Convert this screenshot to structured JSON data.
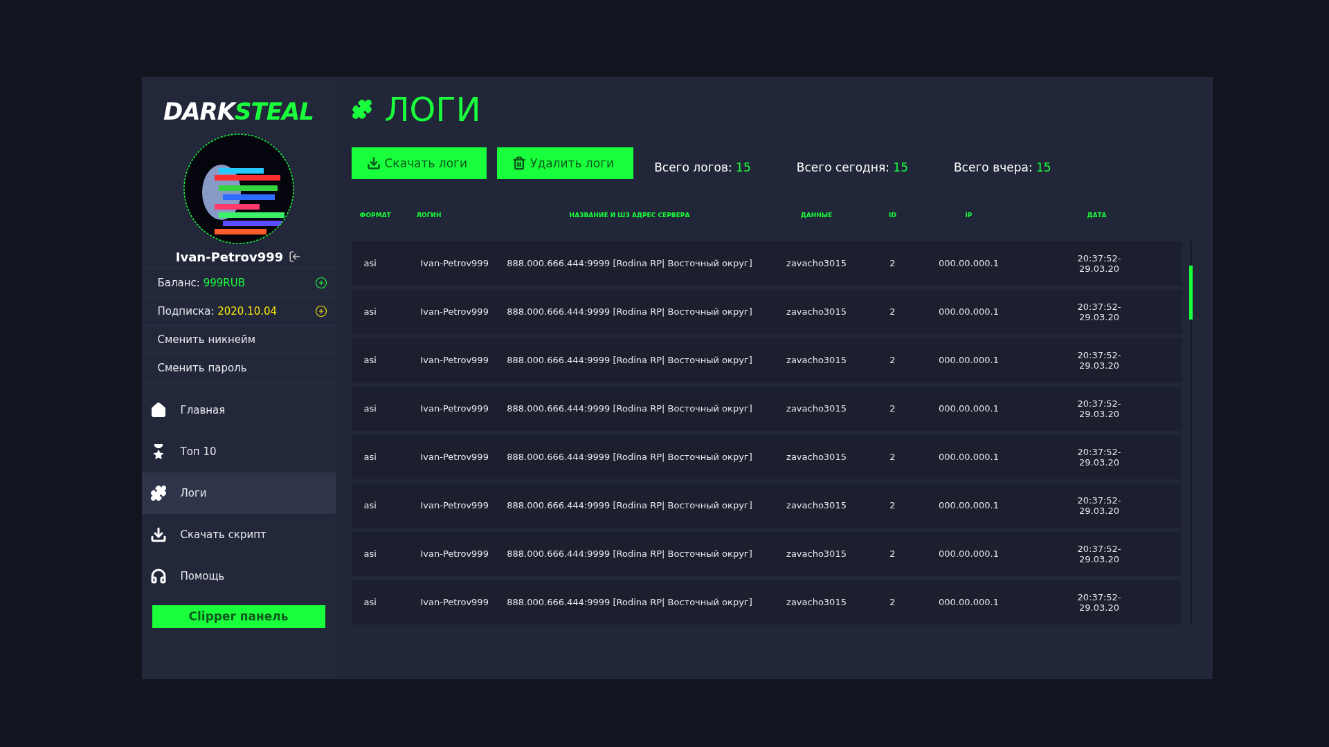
{
  "logo": {
    "part_1": "DARK",
    "part_2": "STEAL"
  },
  "user": {
    "name": "Ivan-Petrov999"
  },
  "account": [
    {
      "kind": "balance",
      "label": "Баланс:",
      "value": "999RUB",
      "color": "#19ff3c"
    },
    {
      "kind": "balance",
      "label": "Подписка:",
      "value": "2020.10.04",
      "color": "#f5e50f"
    },
    {
      "kind": "link",
      "label": "Сменить никнейм"
    },
    {
      "kind": "link",
      "label": "Сменить пароль"
    }
  ],
  "nav": [
    {
      "label": "Главная",
      "selected": false
    },
    {
      "label": "Топ 10",
      "selected": false
    },
    {
      "label": "Логи",
      "selected": true
    },
    {
      "label": "Скачать скрипт",
      "selected": false
    },
    {
      "label": "Помощь",
      "selected": false
    }
  ],
  "clipper_button": "Clipper панель",
  "page_title": "ЛОГИ",
  "actions": [
    {
      "label": "Скачать логи"
    },
    {
      "label": "Удалить логи"
    }
  ],
  "stats": [
    {
      "label": "Всего логов:",
      "value": "15"
    },
    {
      "label": "Всего сегодня:",
      "value": "15"
    },
    {
      "label": "Всего вчера:",
      "value": "15"
    }
  ],
  "table": {
    "columns": [
      "ФОРМАТ",
      "ЛОГИН",
      "НАЗВАНИЕ И ШЗ АДРЕС СЕРВЕРА",
      "ДАННЫЕ",
      "ID",
      "IP",
      "ДАТА"
    ],
    "rows": [
      [
        "asi",
        "Ivan-Petrov999",
        "888.000.666.444:9999 [Rodina RP| Восточный округ]",
        "zavacho3015",
        "2",
        "000.00.000.1",
        "20:37:52-\n29.03.20"
      ],
      [
        "asi",
        "Ivan-Petrov999",
        "888.000.666.444:9999 [Rodina RP| Восточный округ]",
        "zavacho3015",
        "2",
        "000.00.000.1",
        "20:37:52-\n29.03.20"
      ],
      [
        "asi",
        "Ivan-Petrov999",
        "888.000.666.444:9999 [Rodina RP| Восточный округ]",
        "zavacho3015",
        "2",
        "000.00.000.1",
        "20:37:52-\n29.03.20"
      ],
      [
        "asi",
        "Ivan-Petrov999",
        "888.000.666.444:9999 [Rodina RP| Восточный округ]",
        "zavacho3015",
        "2",
        "000.00.000.1",
        "20:37:52-\n29.03.20"
      ],
      [
        "asi",
        "Ivan-Petrov999",
        "888.000.666.444:9999 [Rodina RP| Восточный округ]",
        "zavacho3015",
        "2",
        "000.00.000.1",
        "20:37:52-\n29.03.20"
      ],
      [
        "asi",
        "Ivan-Petrov999",
        "888.000.666.444:9999 [Rodina RP| Восточный округ]",
        "zavacho3015",
        "2",
        "000.00.000.1",
        "20:37:52-\n29.03.20"
      ],
      [
        "asi",
        "Ivan-Petrov999",
        "888.000.666.444:9999 [Rodina RP| Восточный округ]",
        "zavacho3015",
        "2",
        "000.00.000.1",
        "20:37:52-\n29.03.20"
      ],
      [
        "asi",
        "Ivan-Petrov999",
        "888.000.666.444:9999 [Rodina RP| Восточный округ]",
        "zavacho3015",
        "2",
        "000.00.000.1",
        "20:37:52-\n29.03.20"
      ]
    ]
  }
}
